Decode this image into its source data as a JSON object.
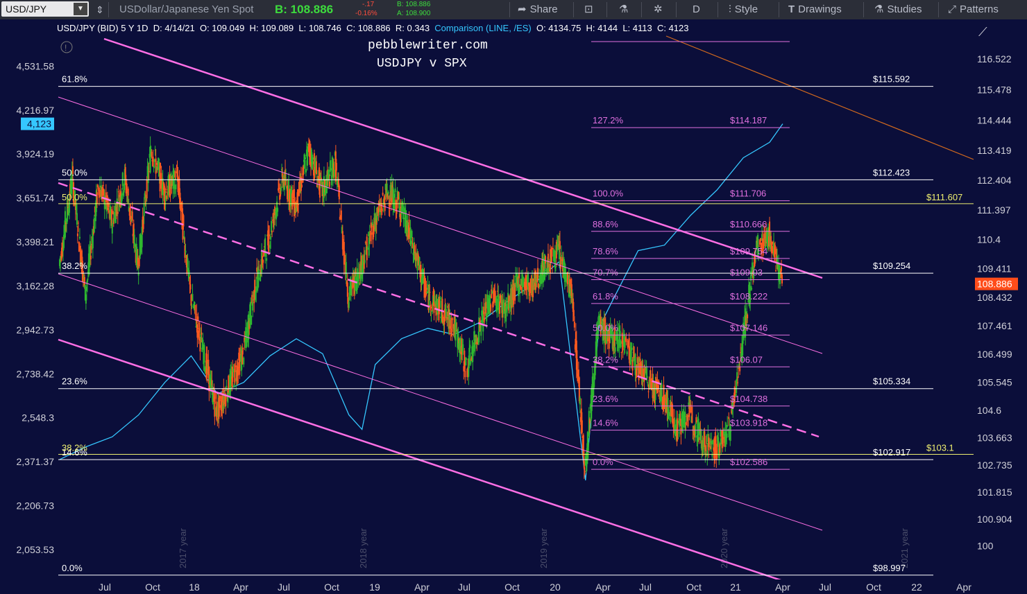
{
  "toolbar": {
    "symbol": "USD/JPY",
    "description": "USDollar/Japanese Yen Spot",
    "bid": "B: 108.886",
    "change": "-.17",
    "change_pct": "-0.16%",
    "bid_small": "B: 108.886",
    "ask_small": "A: 108.900",
    "share": "Share",
    "period": "D",
    "style": "Style",
    "drawings": "Drawings",
    "studies": "Studies",
    "patterns": "Patterns",
    "colors": {
      "bid": "#3ddc3d",
      "change": "#ff4d3d",
      "bg": "#2b2e38"
    }
  },
  "infobar": {
    "title": "USD/JPY (BID) 5 Y 1D",
    "date": "D: 4/14/21",
    "open": "O: 109.049",
    "high": "H: 109.089",
    "low": "L: 108.746",
    "close": "C: 108.886",
    "range": "R: 0.343",
    "comparison": "Comparison (LINE, /ES)",
    "cmp_open": "O: 4134.75",
    "cmp_high": "H: 4144",
    "cmp_low": "L: 4113",
    "cmp_close": "C: 4123"
  },
  "chart_data": {
    "type": "line",
    "title": "USD/JPY (BID) 5 Y 1D",
    "annotations": [
      "pebblewriter.com",
      "USDJPY v SPX"
    ],
    "x_ticks": [
      "Jul",
      "Oct",
      "18",
      "Apr",
      "Jul",
      "Oct",
      "19",
      "Apr",
      "Jul",
      "Oct",
      "20",
      "Apr",
      "Jul",
      "Oct",
      "21",
      "Apr",
      "Jul",
      "Oct",
      "22",
      "Apr"
    ],
    "year_markers": [
      "2017 year",
      "2018 year",
      "2019 year",
      "2020 year",
      "2021 year"
    ],
    "left_axis_ticks": [
      "4,531.58",
      "4,216.97",
      "3,924.19",
      "3,651.74",
      "3,398.21",
      "3,162.28",
      "2,942.73",
      "2,738.42",
      "2,548.3",
      "2,371.37",
      "2,206.73",
      "2,053.53"
    ],
    "left_axis_current": "4,123",
    "right_axis_ticks": [
      "116.522",
      "115.478",
      "114.444",
      "113.419",
      "112.404",
      "111.397",
      "110.4",
      "109.411",
      "108.432",
      "107.461",
      "106.499",
      "105.545",
      "104.6",
      "103.663",
      "102.735",
      "101.815",
      "100.904",
      "100"
    ],
    "right_axis_current": "108.886",
    "right_axis_range": [
      98.9,
      117.3
    ],
    "left_axis_scale": "log",
    "grid": false,
    "series": [
      {
        "name": "USD/JPY",
        "style": "candlestick",
        "color_up": "#2fb82f",
        "color_down": "#ff5a1e",
        "points": [
          [
            0,
            109.5
          ],
          [
            1,
            112.5
          ],
          [
            2,
            108.5
          ],
          [
            3,
            112.3
          ],
          [
            4,
            111.0
          ],
          [
            5,
            112.5
          ],
          [
            6,
            109.5
          ],
          [
            7,
            113.5
          ],
          [
            8,
            112.0
          ],
          [
            9,
            112.5
          ],
          [
            10,
            108.5
          ],
          [
            11,
            106.5
          ],
          [
            12,
            104.5
          ],
          [
            13,
            105.5
          ],
          [
            14,
            106.5
          ],
          [
            15,
            109.0
          ],
          [
            16,
            110.5
          ],
          [
            17,
            112.5
          ],
          [
            18,
            111.5
          ],
          [
            19,
            113.5
          ],
          [
            20,
            112.0
          ],
          [
            21,
            113.0
          ],
          [
            22,
            108.5
          ],
          [
            23,
            109.5
          ],
          [
            24,
            111.0
          ],
          [
            25,
            112.0
          ],
          [
            26,
            111.5
          ],
          [
            27,
            110.0
          ],
          [
            28,
            108.5
          ],
          [
            29,
            108.0
          ],
          [
            30,
            107.5
          ],
          [
            31,
            106.0
          ],
          [
            32,
            107.5
          ],
          [
            33,
            108.5
          ],
          [
            34,
            108.0
          ],
          [
            35,
            109.0
          ],
          [
            36,
            108.8
          ],
          [
            37,
            109.5
          ],
          [
            38,
            110.0
          ],
          [
            39,
            108.5
          ],
          [
            40,
            102.6
          ],
          [
            41,
            107.5
          ],
          [
            42,
            107.0
          ],
          [
            43,
            107.0
          ],
          [
            44,
            106.0
          ],
          [
            45,
            105.5
          ],
          [
            46,
            105.0
          ],
          [
            47,
            104.0
          ],
          [
            48,
            104.5
          ],
          [
            49,
            103.5
          ],
          [
            50,
            103.3
          ],
          [
            51,
            104.0
          ],
          [
            52,
            107.0
          ],
          [
            53,
            110.0
          ],
          [
            54,
            110.6
          ],
          [
            55,
            108.9
          ]
        ]
      },
      {
        "name": "SPX",
        "style": "line",
        "color": "#35c7ff",
        "points": [
          [
            0,
            2380
          ],
          [
            2,
            2430
          ],
          [
            4,
            2470
          ],
          [
            6,
            2560
          ],
          [
            8,
            2700
          ],
          [
            10,
            2820
          ],
          [
            12,
            2650
          ],
          [
            14,
            2700
          ],
          [
            16,
            2820
          ],
          [
            18,
            2900
          ],
          [
            20,
            2830
          ],
          [
            22,
            2560
          ],
          [
            23,
            2500
          ],
          [
            24,
            2780
          ],
          [
            26,
            2900
          ],
          [
            28,
            2950
          ],
          [
            30,
            2920
          ],
          [
            32,
            2980
          ],
          [
            34,
            3080
          ],
          [
            36,
            3170
          ],
          [
            38,
            3290
          ],
          [
            40,
            2300
          ],
          [
            41,
            2950
          ],
          [
            42,
            3080
          ],
          [
            44,
            3350
          ],
          [
            46,
            3380
          ],
          [
            48,
            3550
          ],
          [
            50,
            3700
          ],
          [
            52,
            3900
          ],
          [
            54,
            4000
          ],
          [
            55,
            4123
          ]
        ]
      }
    ],
    "fib_retracement_white": [
      {
        "label": "61.8%",
        "price": "$115.592",
        "y": 115.59
      },
      {
        "label": "50.0%",
        "price": "$112.423",
        "y": 112.42
      },
      {
        "label": "38.2%",
        "price": "$109.254",
        "y": 109.25
      },
      {
        "label": "23.6%",
        "price": "$105.334",
        "y": 105.33
      },
      {
        "label": "14.6%",
        "price": "$102.917",
        "y": 102.92
      },
      {
        "label": "0.0%",
        "price": "$98.997",
        "y": 99.0
      }
    ],
    "fib_retracement_yellow": [
      {
        "label": "50.0%",
        "price": "$111.607",
        "y": 111.61
      },
      {
        "label": "38.2%",
        "price": "$103.1",
        "y": 103.1
      }
    ],
    "fib_extension_pink": [
      {
        "label": "127.2%",
        "price": "$114.187",
        "y": 114.19
      },
      {
        "label": "100.0%",
        "price": "$111.706",
        "y": 111.71
      },
      {
        "label": "88.6%",
        "price": "$110.666",
        "y": 110.67
      },
      {
        "label": "78.6%",
        "price": "$109.754",
        "y": 109.75
      },
      {
        "label": "70.7%",
        "price": "$109.03",
        "y": 109.03
      },
      {
        "label": "61.8%",
        "price": "$108.222",
        "y": 108.22
      },
      {
        "label": "50.0%",
        "price": "$107.146",
        "y": 107.15
      },
      {
        "label": "38.2%",
        "price": "$106.07",
        "y": 106.07
      },
      {
        "label": "23.6%",
        "price": "$104.738",
        "y": 104.74
      },
      {
        "label": "14.6%",
        "price": "$103.918",
        "y": 103.92
      },
      {
        "label": "0.0%",
        "price": "$102.586",
        "y": 102.59
      }
    ],
    "colors": {
      "background": "#0b0e3a",
      "fib_white": "#ffffff",
      "fib_yellow": "#f0f070",
      "fib_pink": "#e070e0",
      "channel": "#ff6fe6",
      "trend_orange": "#d2691e"
    }
  }
}
